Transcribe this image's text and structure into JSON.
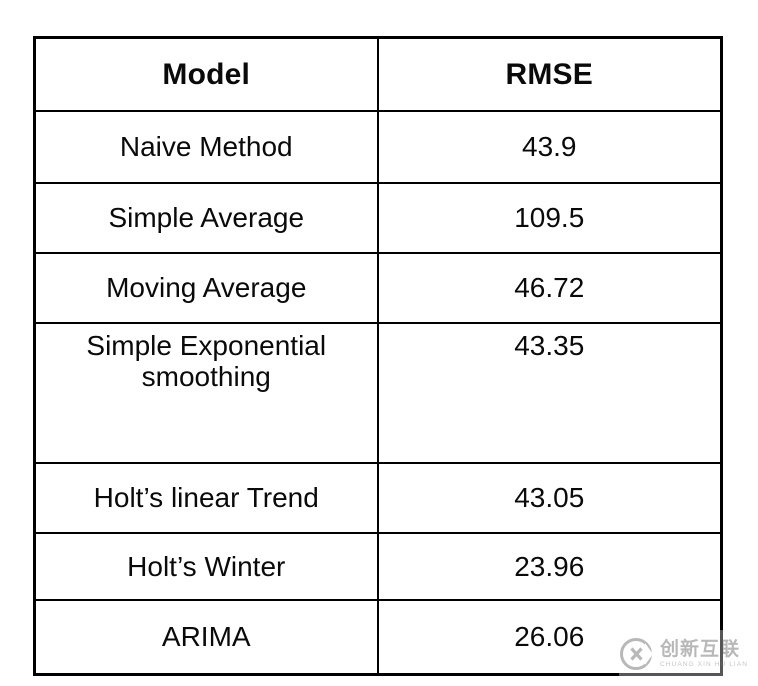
{
  "table": {
    "columns": [
      "Model",
      "RMSE"
    ],
    "rows": [
      {
        "model": "Naive Method",
        "rmse": "43.9"
      },
      {
        "model": "Simple Average",
        "rmse": "109.5"
      },
      {
        "model": "Moving Average",
        "rmse": "46.72"
      },
      {
        "model": "Simple Exponential smoothing",
        "rmse": "43.35"
      },
      {
        "model": "Holt’s linear Trend",
        "rmse": "43.05"
      },
      {
        "model": "Holt’s Winter",
        "rmse": "23.96"
      },
      {
        "model": "ARIMA",
        "rmse": "26.06"
      }
    ]
  },
  "watermark": {
    "chinese": "创新互联",
    "pinyin": "CHUANG XIN HU LIAN",
    "mark_letters": "CX",
    "color": "#8d8d8d"
  },
  "style": {
    "border_color": "#000000",
    "text_color": "#0a0a0a",
    "background": "#ffffff"
  }
}
